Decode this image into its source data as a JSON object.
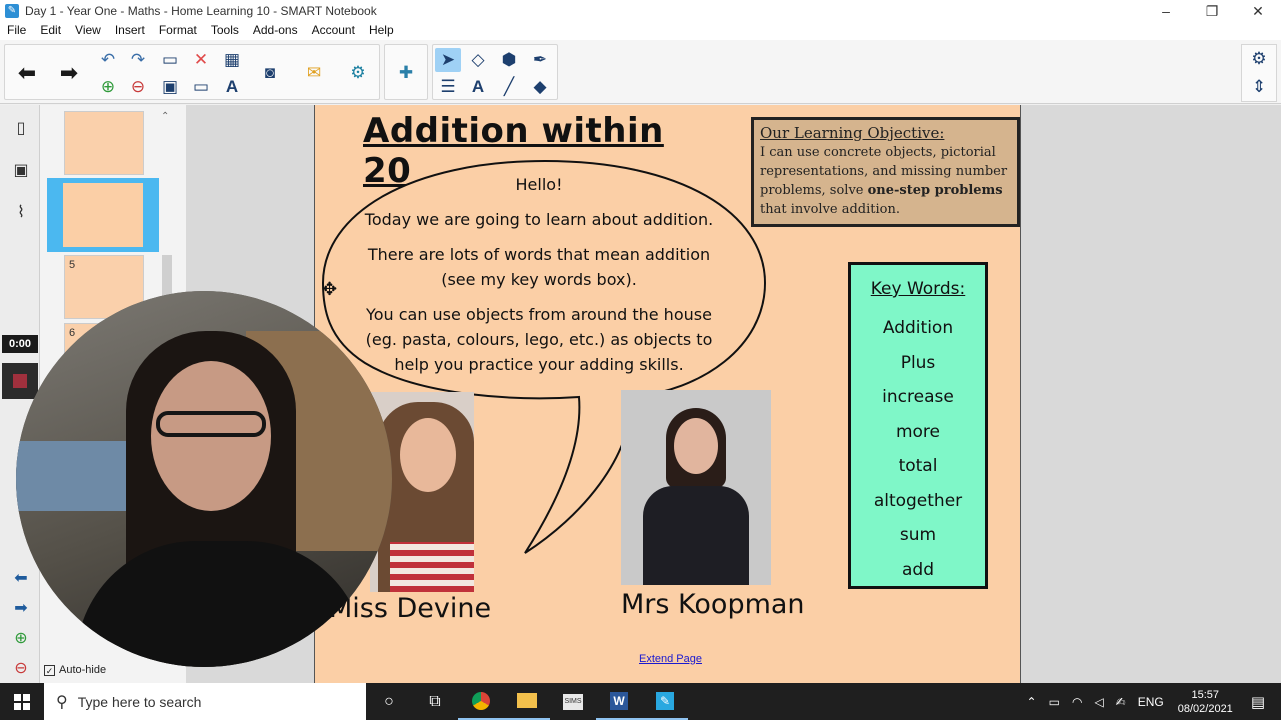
{
  "window": {
    "title": "Day 1 - Year One - Maths - Home Learning 10 - SMART Notebook",
    "controls": [
      "–",
      "❐",
      "✕"
    ]
  },
  "menu": [
    "File",
    "Edit",
    "View",
    "Insert",
    "Format",
    "Tools",
    "Add-ons",
    "Account",
    "Help"
  ],
  "toolbar": {
    "icons": [
      "back-arrow-icon",
      "forward-arrow-icon",
      "undo-icon",
      "redo-icon",
      "paste-icon",
      "delete-icon",
      "table-icon",
      "add-page-icon",
      "delete-page-icon",
      "save-icon",
      "screen-shade-icon",
      "text-recognition-icon",
      "document-camera-icon",
      "response-icon",
      "lab-activity-icon",
      "addons-icon",
      "select-icon",
      "shapes-icon",
      "fill-icon",
      "pen-icon",
      "properties-icon",
      "text-icon",
      "line-icon",
      "eraser-icon",
      "settings-icon",
      "move-toolbar-icon"
    ]
  },
  "sidebar": {
    "timer": "0:00",
    "thumbnails": [
      {
        "num": ""
      },
      {
        "num": ""
      },
      {
        "num": "5"
      },
      {
        "num": "6"
      }
    ],
    "autohide_label": "Auto-hide"
  },
  "page": {
    "title": "Addition within 20",
    "objective": {
      "title": "Our Learning Objective:",
      "text_before": "I can use concrete objects, pictorial representations, and missing number problems, solve ",
      "bold": "one-step problems",
      "text_after": " that involve addition."
    },
    "bubble": {
      "line1": "Hello!",
      "line2": "Today we are going to learn about addition.",
      "line3a": "There are lots of words that mean addition",
      "line3b": "(see my key words box).",
      "line4a": "You can use objects from around the house",
      "line4b": "(eg. pasta, colours, lego, etc.) as objects to",
      "line4c": "help you practice your adding skills."
    },
    "keywords": {
      "title": "Key Words:",
      "words": [
        "Addition",
        "Plus",
        "increase",
        "more",
        "total",
        "altogether",
        "sum",
        "add"
      ]
    },
    "captions": {
      "left": "Miss Devine",
      "right": "Mrs Koopman"
    },
    "extend_link": "Extend Page"
  },
  "taskbar": {
    "search_placeholder": "Type here to search",
    "language": "ENG",
    "time": "15:57",
    "date": "08/02/2021",
    "apps": [
      "cortana-icon",
      "task-view-icon",
      "chrome-icon",
      "file-explorer-icon",
      "sims-icon",
      "word-icon",
      "smart-notebook-icon"
    ]
  },
  "colors": {
    "page_bg": "#fbcfa6",
    "objective_bg": "#d5b48e",
    "keywords_bg": "#7ff7c8",
    "selection_blue": "#4bb8f0"
  }
}
